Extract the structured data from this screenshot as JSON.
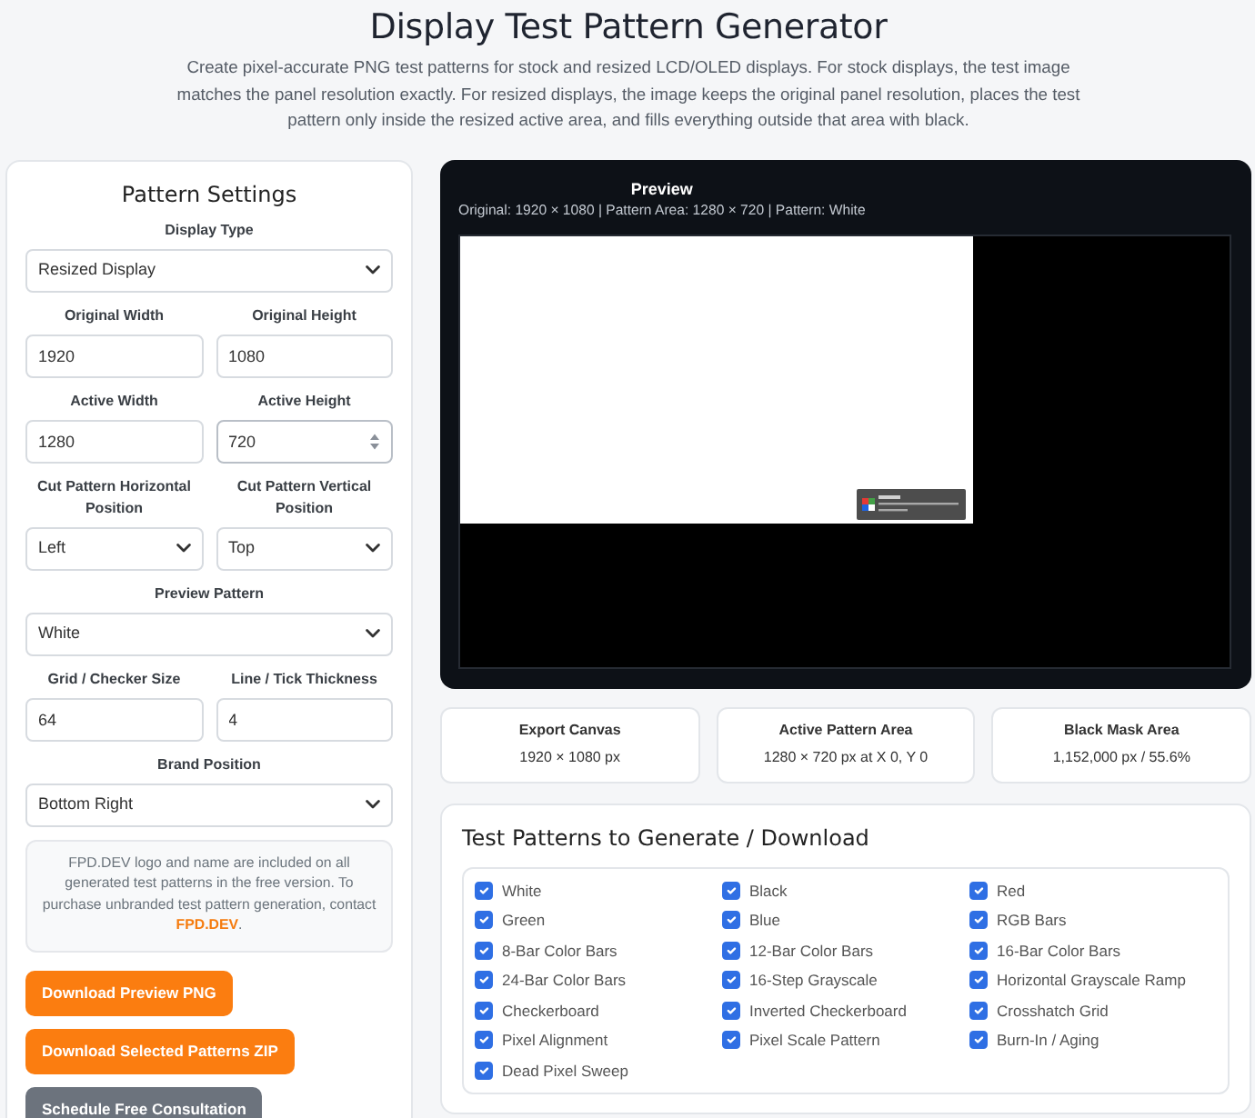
{
  "header": {
    "title": "Display Test Pattern Generator",
    "description": "Create pixel-accurate PNG test patterns for stock and resized LCD/OLED displays. For stock displays, the test image matches the panel resolution exactly. For resized displays, the image keeps the original panel resolution, places the test pattern only inside the resized active area, and fills everything outside that area with black."
  },
  "settings": {
    "title": "Pattern Settings",
    "rows": [
      {
        "fields": [
          {
            "kind": "select",
            "label": "Display Type",
            "value": "Resized Display"
          }
        ]
      },
      {
        "fields": [
          {
            "kind": "number",
            "label": "Original Width",
            "value": "1920",
            "hovered": false
          },
          {
            "kind": "number",
            "label": "Original Height",
            "value": "1080",
            "hovered": false
          }
        ]
      },
      {
        "fields": [
          {
            "kind": "number",
            "label": "Active Width",
            "value": "1280",
            "hovered": false
          },
          {
            "kind": "number",
            "label": "Active Height",
            "value": "720",
            "hovered": true
          }
        ]
      },
      {
        "fields": [
          {
            "kind": "select",
            "label": "Cut Pattern Horizontal Position",
            "value": "Left"
          },
          {
            "kind": "select",
            "label": "Cut Pattern Vertical Position",
            "value": "Top"
          }
        ]
      },
      {
        "fields": [
          {
            "kind": "select",
            "label": "Preview Pattern",
            "value": "White"
          }
        ]
      },
      {
        "fields": [
          {
            "kind": "number",
            "label": "Grid / Checker Size",
            "value": "64",
            "hovered": false
          },
          {
            "kind": "number",
            "label": "Line / Tick Thickness",
            "value": "4",
            "hovered": false
          }
        ]
      },
      {
        "fields": [
          {
            "kind": "select",
            "label": "Brand Position",
            "value": "Bottom Right"
          }
        ]
      }
    ],
    "note": {
      "text": "FPD.DEV logo and name are included on all generated test patterns in the free version. To purchase unbranded test pattern generation, contact",
      "link": "FPD.DEV",
      "end": "."
    },
    "buttons": [
      {
        "label": "Download Preview PNG",
        "kind": "primary"
      },
      {
        "label": "Download Selected Patterns ZIP",
        "kind": "primary"
      },
      {
        "label": "Schedule Free Consultation",
        "kind": "secondary"
      }
    ]
  },
  "preview": {
    "title": "Preview",
    "subtitle": "Original: 1920 × 1080 | Pattern Area: 1280 × 720 | Pattern: White"
  },
  "stats": [
    {
      "label": "Export Canvas",
      "value": "1920 × 1080 px"
    },
    {
      "label": "Active Pattern Area",
      "value": "1280 × 720 px at X 0, Y 0"
    },
    {
      "label": "Black Mask Area",
      "value": "1,152,000 px / 55.6%"
    }
  ],
  "patterns": {
    "title": "Test Patterns to Generate / Download",
    "items": [
      {
        "label": "White",
        "checked": true
      },
      {
        "label": "Black",
        "checked": true
      },
      {
        "label": "Red",
        "checked": true
      },
      {
        "label": "Green",
        "checked": true
      },
      {
        "label": "Blue",
        "checked": true
      },
      {
        "label": "RGB Bars",
        "checked": true
      },
      {
        "label": "8-Bar Color Bars",
        "checked": true
      },
      {
        "label": "12-Bar Color Bars",
        "checked": true
      },
      {
        "label": "16-Bar Color Bars",
        "checked": true
      },
      {
        "label": "24-Bar Color Bars",
        "checked": true
      },
      {
        "label": "16-Step Grayscale",
        "checked": true
      },
      {
        "label": "Horizontal Grayscale Ramp",
        "checked": true
      },
      {
        "label": "Checkerboard",
        "checked": true
      },
      {
        "label": "Inverted Checkerboard",
        "checked": true
      },
      {
        "label": "Crosshatch Grid",
        "checked": true
      },
      {
        "label": "Pixel Alignment",
        "checked": true
      },
      {
        "label": "Pixel Scale Pattern",
        "checked": true
      },
      {
        "label": "Burn-In / Aging",
        "checked": true
      },
      {
        "label": "Dead Pixel Sweep",
        "checked": true
      }
    ]
  }
}
